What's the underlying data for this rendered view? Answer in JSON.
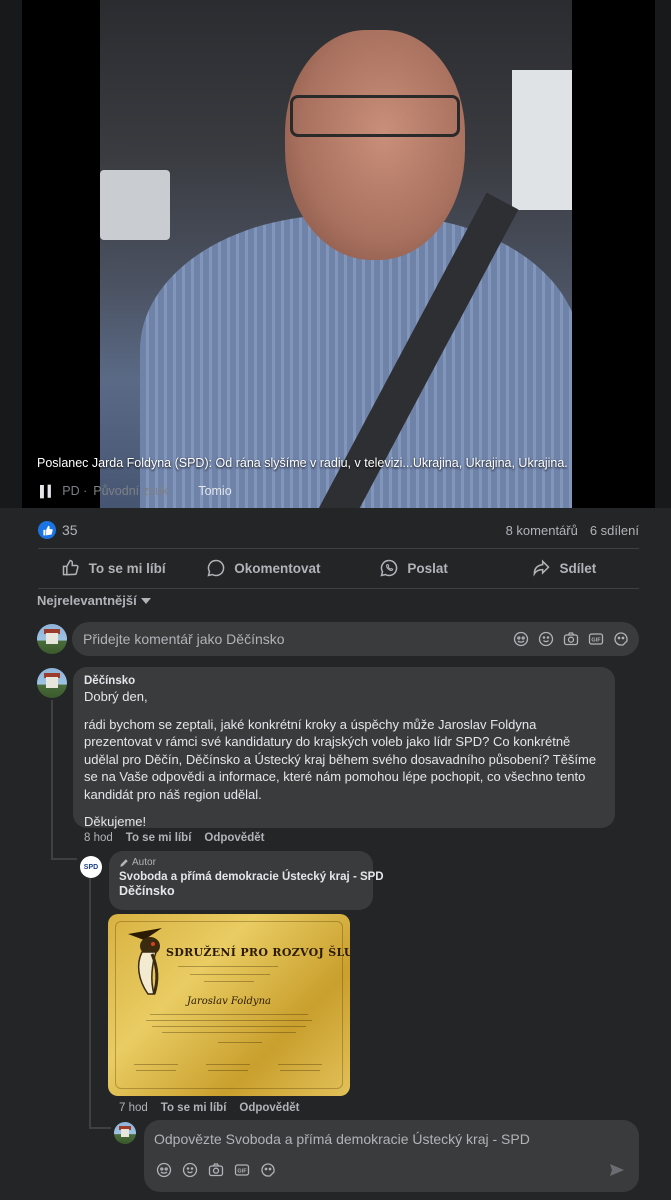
{
  "video": {
    "caption": "Poslanec Jarda Foldyna (SPD): Od rána slyšíme v radiu, v televizi...Ukrajina, Ukrajina, Ukrajina.",
    "audio_prefix": "PD ·",
    "audio_label": "Původní zvuk",
    "channel": "Tomio"
  },
  "stats": {
    "likes": "35",
    "comments": "8 komentářů",
    "shares": "6 sdílení"
  },
  "actions": {
    "like": "To se mi líbí",
    "comment": "Okomentovat",
    "send": "Poslat",
    "share": "Sdílet"
  },
  "sort": {
    "label": "Nejrelevantnější"
  },
  "composer": {
    "placeholder": "Přidejte komentář jako Děčínsko"
  },
  "comment1": {
    "author": "Děčínsko",
    "greeting": "Dobrý den,",
    "body": "rádi bychom se zeptali, jaké konkrétní kroky a úspěchy může Jaroslav Foldyna prezentovat v rámci své kandidatury do krajských voleb jako lídr SPD? Co konkrétně udělal pro Děčín, Děčínsko a Ústecký kraj během svého dosavadního působení? Těšíme se na Vaše odpovědi a informace, které nám pomohou lépe pochopit, co všechno tento kandidát pro náš region udělal.",
    "thanks": "Děkujeme!",
    "time": "8 hod",
    "like": "To se mi líbí",
    "reply": "Odpovědět"
  },
  "comment2": {
    "badge": "Autor",
    "avatar_text": "SPD",
    "author": "Svoboda a přímá demokracie Ústecký kraj - SPD",
    "mention": "Děčínsko",
    "image_title": "SDRUŽENÍ PRO ROZVOJ ŠLUKNOVSKA",
    "image_name": "Jaroslav Foldyna",
    "time": "7 hod",
    "like": "To se mi líbí",
    "reply": "Odpovědět"
  },
  "reply_box": {
    "placeholder": "Odpovězte Svoboda a přímá demokracie Ústecký kraj - SPD"
  },
  "colors": {
    "background": "#242526",
    "bubble": "#3a3b3c",
    "like_blue": "#1b74e4",
    "text": "#e4e6eb",
    "muted": "#b0b3b8"
  },
  "icons": [
    "like-icon",
    "comment-icon",
    "whatsapp-icon",
    "share-icon",
    "sticker-icon",
    "emoji-icon",
    "camera-icon",
    "gif-icon",
    "avatar-sticker-icon",
    "send-icon",
    "pencil-icon",
    "audio-icon"
  ]
}
